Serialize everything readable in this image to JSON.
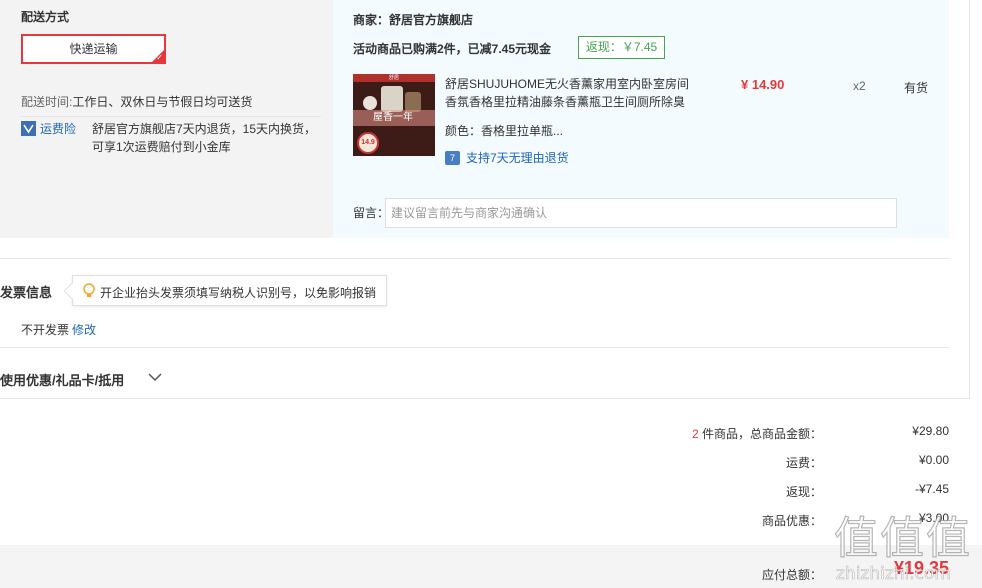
{
  "shipping": {
    "title": "配送方式",
    "option": "快递运输",
    "time_label": "配送时间:",
    "time_value": "工作日、双休日与节假日均可送货",
    "insurance_icon": "shield-icon",
    "insurance_label": "运费险",
    "insurance_desc": "舒居官方旗舰店7天内退货，15天内换货，可享1次运费赔付到小金库"
  },
  "order": {
    "shop": "商家：舒居官方旗舰店",
    "promo": "活动商品已购满2件，已减7.45元现金",
    "rebate": "返现：￥7.45",
    "product": {
      "image_badge": "舒居",
      "image_slogan": "屋香一年",
      "image_price": "14.9",
      "name": "舒居SHUJUHOME无火香薰家用室内卧室房间香氛香格里拉精油藤条香薰瓶卫生间厕所除臭",
      "color": "颜色：香格里拉单瓶...",
      "return_icon": "return-7-icon",
      "return_glyph": "7",
      "return_label": "支持7天无理由退货",
      "price": "¥ 14.90",
      "qty": "x2",
      "stock": "有货"
    },
    "remark_label": "留言：",
    "remark_placeholder": "建议留言前先与商家沟通确认"
  },
  "invoice": {
    "title": "发票信息",
    "tip_icon": "lightbulb-icon",
    "tip": "开企业抬头发票须填写纳税人识别号，以免影响报销",
    "value": "不开发票",
    "edit": "修改"
  },
  "coupon": {
    "title": "使用优惠/礼品卡/抵用",
    "icon": "chevron-down-icon"
  },
  "summary": {
    "count": "2",
    "goods_label": " 件商品，总商品金额：",
    "goods_value": "¥29.80",
    "shipping_label": "运费：",
    "shipping_value": "¥0.00",
    "rebate_label": "返现：",
    "rebate_value": "-¥7.45",
    "discount_label": "商品优惠：",
    "discount_value": "¥3.00",
    "pay_label": "应付总额：",
    "pay_value": "¥19.35"
  },
  "watermark": {
    "text": "值",
    "url": "zhizhizhi.com"
  },
  "colors": {
    "accent": "#e4393c",
    "link": "#1f66b3",
    "green": "#46a34c"
  }
}
